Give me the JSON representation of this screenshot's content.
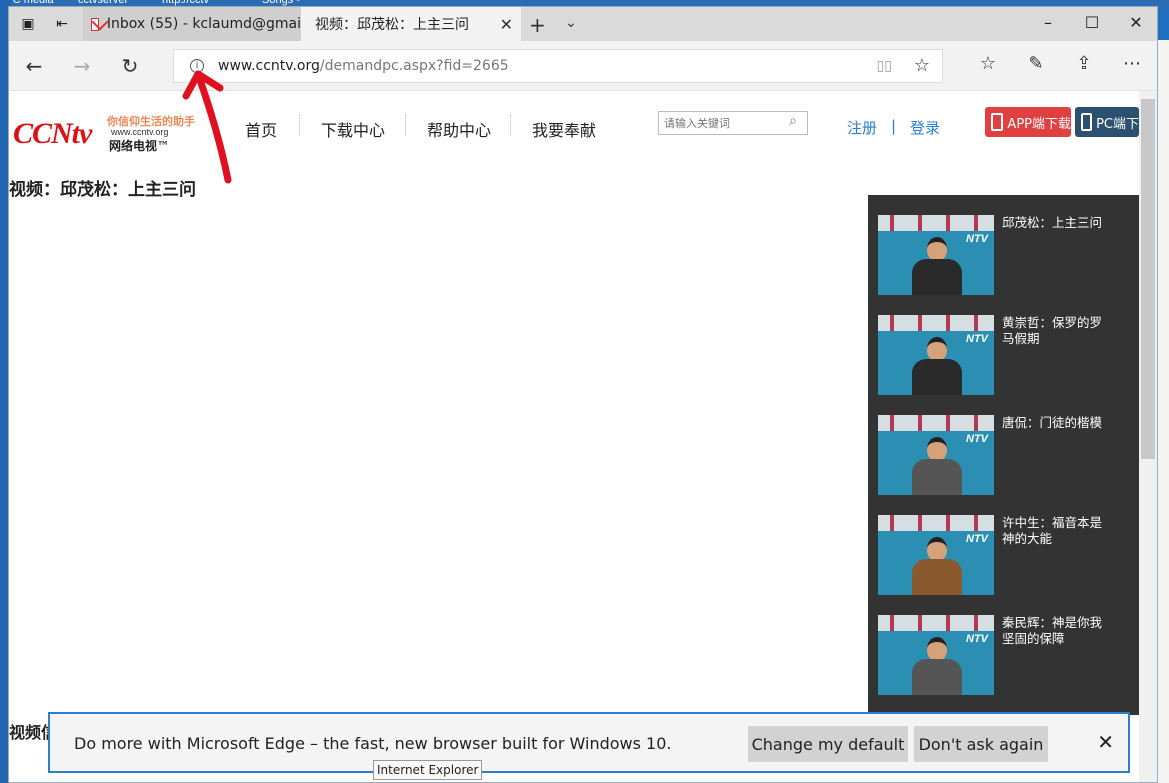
{
  "browser": {
    "tabs": [
      {
        "label": "Inbox (55) - kclaumd@gmai",
        "icon": "gmail-icon"
      },
      {
        "label": "视频：邱茂松：上主三问",
        "active": true
      }
    ],
    "url_host": "www.ccntv.org",
    "url_path": "/demandpc.aspx?fid=2665"
  },
  "site": {
    "logo_text": "CCNtv",
    "slogan": "你信仰生活的助手",
    "site_url": "www.ccntv.org",
    "logo_cn": "网络电视™",
    "nav": [
      "首页",
      "下载中心",
      "帮助中心",
      "我要奉献"
    ],
    "search_placeholder": "请输入关键词",
    "register": "注册",
    "divider": "|",
    "login": "登录",
    "app_download": "APP端下载",
    "pc_download": "PC端下",
    "video_title": "视频：邱茂松：上主三问",
    "video_info": "视频信"
  },
  "playlist": [
    {
      "title": "邱茂松：上主三问"
    },
    {
      "title": "黄崇哲：保罗的罗马假期"
    },
    {
      "title": "唐侃：门徒的楷模"
    },
    {
      "title": "许中生：福音本是神的大能"
    },
    {
      "title": "秦民辉：神是你我坚固的保障"
    }
  ],
  "banner": {
    "message": "Do more with Microsoft Edge – the fast, new browser built for Windows 10.",
    "change_default": "Change my default",
    "dont_ask": "Don't ask again"
  },
  "tooltip": "Internet Explorer",
  "colors": {
    "accent": "#2a7fd0",
    "app_button": "#e04040",
    "pc_button": "#2b5070",
    "annotation_arrow": "#e01020"
  }
}
